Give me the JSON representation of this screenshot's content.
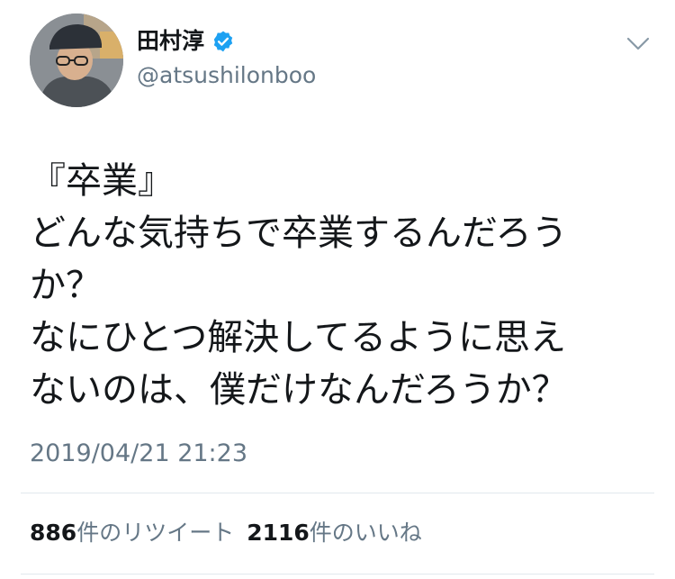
{
  "author": {
    "display_name": "田村淳",
    "handle": "@atsushilonboo",
    "verified": true,
    "avatar_icon": "user-avatar",
    "verified_icon": "verified-badge-icon"
  },
  "tweet": {
    "lines": [
      "『卒業』",
      "どんな気持ちで卒業するんだろう",
      "か？",
      "なにひとつ解決してるように思え",
      "ないのは、僕だけなんだろうか？"
    ],
    "timestamp": "2019/04/21 21:23"
  },
  "stats": {
    "retweet_count": "886",
    "retweet_label": "件のリツイート",
    "like_count": "2116",
    "like_label": "件のいいね"
  },
  "colors": {
    "text": "#14171a",
    "secondary": "#657786",
    "verified": "#1da1f2",
    "divider": "#e1e8ed"
  }
}
